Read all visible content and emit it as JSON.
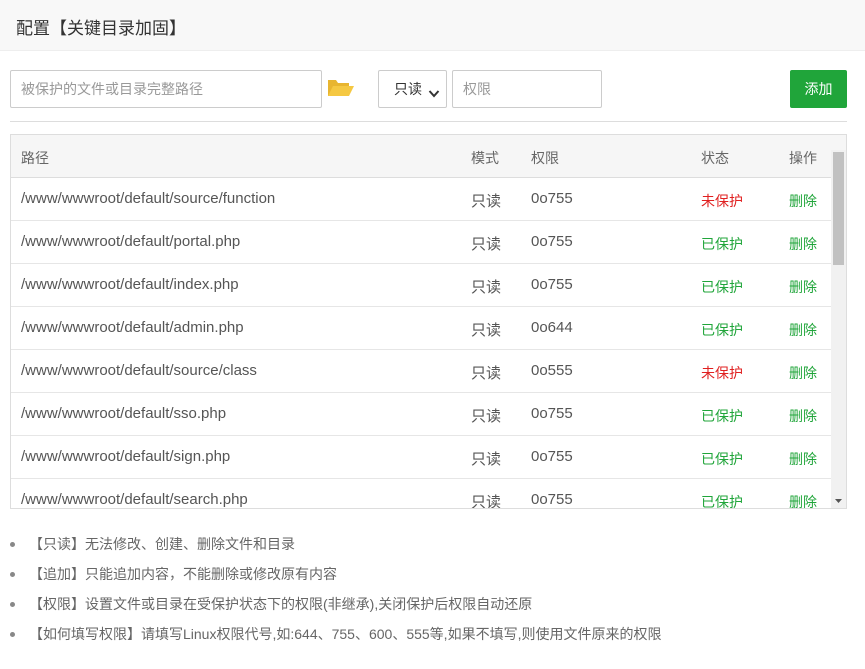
{
  "dialog": {
    "title": "配置【关键目录加固】"
  },
  "form": {
    "path_placeholder": "被保护的文件或目录完整路径",
    "path_value": "",
    "mode_selected": "只读",
    "perm_placeholder": "权限",
    "perm_value": "",
    "add_label": "添加"
  },
  "table": {
    "headers": {
      "path": "路径",
      "mode": "模式",
      "perm": "权限",
      "state": "状态",
      "op": "操作"
    },
    "rows": [
      {
        "path": "/www/wwwroot/default/source/function",
        "mode": "只读",
        "perm": "0o755",
        "state": "未保护",
        "state_type": "unprotected",
        "op": "删除"
      },
      {
        "path": "/www/wwwroot/default/portal.php",
        "mode": "只读",
        "perm": "0o755",
        "state": "已保护",
        "state_type": "protected",
        "op": "删除"
      },
      {
        "path": "/www/wwwroot/default/index.php",
        "mode": "只读",
        "perm": "0o755",
        "state": "已保护",
        "state_type": "protected",
        "op": "删除"
      },
      {
        "path": "/www/wwwroot/default/admin.php",
        "mode": "只读",
        "perm": "0o644",
        "state": "已保护",
        "state_type": "protected",
        "op": "删除"
      },
      {
        "path": "/www/wwwroot/default/source/class",
        "mode": "只读",
        "perm": "0o555",
        "state": "未保护",
        "state_type": "unprotected",
        "op": "删除"
      },
      {
        "path": "/www/wwwroot/default/sso.php",
        "mode": "只读",
        "perm": "0o755",
        "state": "已保护",
        "state_type": "protected",
        "op": "删除"
      },
      {
        "path": "/www/wwwroot/default/sign.php",
        "mode": "只读",
        "perm": "0o755",
        "state": "已保护",
        "state_type": "protected",
        "op": "删除"
      },
      {
        "path": "/www/wwwroot/default/search.php",
        "mode": "只读",
        "perm": "0o755",
        "state": "已保护",
        "state_type": "protected",
        "op": "删除"
      }
    ]
  },
  "notes": [
    "【只读】无法修改、创建、删除文件和目录",
    "【追加】只能追加内容，不能删除或修改原有内容",
    "【权限】设置文件或目录在受保护状态下的权限(非继承),关闭保护后权限自动还原",
    "【如何填写权限】请填写Linux权限代号,如:644、755、600、555等,如果不填写,则使用文件原来的权限"
  ],
  "colors": {
    "accent": "#20a53a",
    "danger": "#e02020",
    "folder_icon": "#f0c040"
  },
  "icons": {
    "folder": "folder-open-icon",
    "chevron": "chevron-down-icon",
    "bullet": "bullet-dot-icon"
  }
}
